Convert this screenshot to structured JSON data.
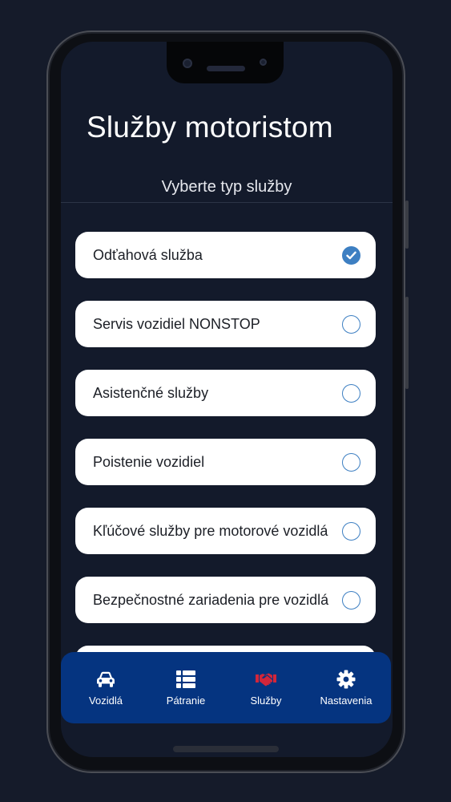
{
  "header": {
    "title": "Služby motoristom",
    "subtitle": "Vyberte typ služby"
  },
  "services": [
    {
      "label": "Odťahová služba",
      "selected": true
    },
    {
      "label": "Servis vozidiel NONSTOP",
      "selected": false
    },
    {
      "label": "Asistenčné služby",
      "selected": false
    },
    {
      "label": "Poistenie vozidiel",
      "selected": false
    },
    {
      "label": "Kľúčové služby pre motorové vozidlá",
      "selected": false
    },
    {
      "label": "Bezpečnostné zariadenia pre vozidlá",
      "selected": false
    }
  ],
  "bottom_nav": {
    "items": [
      {
        "label": "Vozidlá",
        "icon": "car-icon",
        "active": false
      },
      {
        "label": "Pátranie",
        "icon": "list-icon",
        "active": false
      },
      {
        "label": "Služby",
        "icon": "handshake-icon",
        "active": true
      },
      {
        "label": "Nastavenia",
        "icon": "gear-icon",
        "active": false
      }
    ]
  },
  "colors": {
    "background": "#131a2b",
    "accent": "#3d7fc2",
    "nav_background": "#053480",
    "active_icon": "#d2263a"
  }
}
